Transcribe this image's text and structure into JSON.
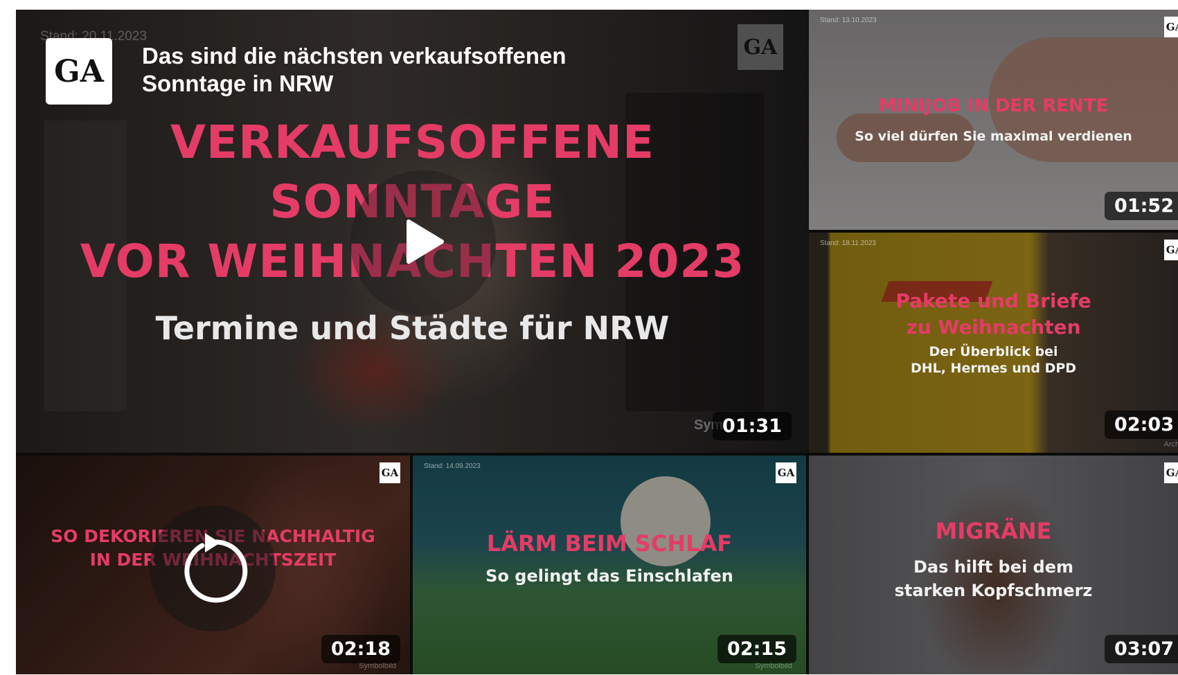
{
  "main_video": {
    "date": "Stand: 20.11.2023",
    "logo": "GA",
    "title_line1": "Das sind die nächsten verkaufsoffenen",
    "title_line2": "Sonntage in NRW",
    "overlay_line1": "VERKAUFSOFFENE",
    "overlay_line2": "SONNTAGE",
    "overlay_line3": "VOR WEIHNACHTEN 2023",
    "overlay_subtitle": "Termine und Städte für NRW",
    "symbol_note": "Sym",
    "duration": "01:31",
    "play_icon": "play-icon"
  },
  "videos": [
    {
      "date": "Stand: 13.10.2023",
      "title": "MINIJOB IN DER RENTE",
      "subtitle": "So viel dürfen Sie maximal verdienen",
      "duration": "01:52",
      "logo": "GA"
    },
    {
      "date": "Stand: 18.11.2023",
      "title_line1": "Pakete und Briefe",
      "title_line2": "zu Weihnachten",
      "subtitle_line1": "Der Überblick bei",
      "subtitle_line2": "DHL, Hermes und DPD",
      "duration": "02:03",
      "logo": "GA",
      "symbol_note": "Archiv"
    },
    {
      "title_line1": "SO DEKORIEREN SIE NACHHALTIG",
      "title_line2": "IN DER WEIHNACHTSZEIT",
      "duration": "02:18",
      "logo": "GA",
      "symbol_note": "Symbolbild",
      "replay_icon": "replay-icon"
    },
    {
      "date": "Stand: 14.09.2023",
      "title": "LÄRM BEIM SCHLAF",
      "subtitle": "So gelingt das Einschlafen",
      "duration": "02:15",
      "logo": "GA",
      "symbol_note": "Symbolbild"
    },
    {
      "title": "MIGRÄNE",
      "subtitle_line1": "Das hilft bei dem",
      "subtitle_line2": "starken Kopfschmerz",
      "duration": "03:07",
      "logo": "GA"
    }
  ],
  "colors": {
    "accent_pink": "#e43c66",
    "background": "#0b0b0b"
  }
}
